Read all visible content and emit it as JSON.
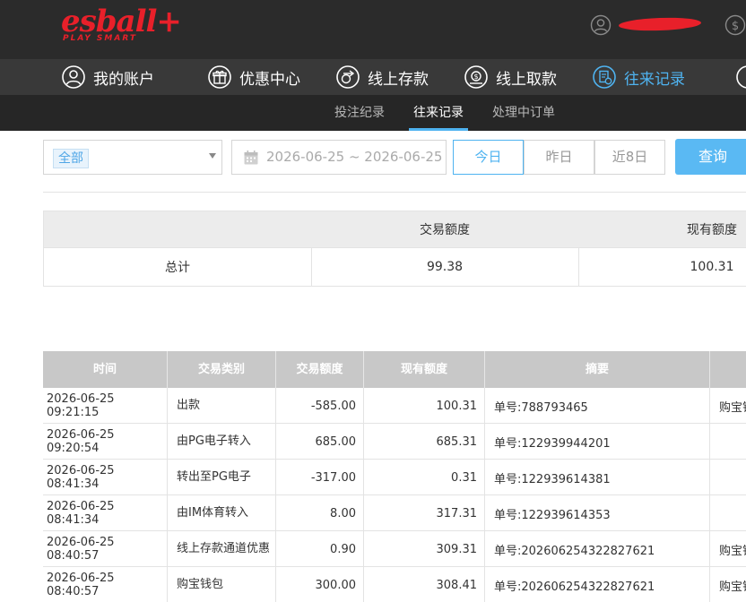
{
  "brand": {
    "logo_text": "esball+",
    "tagline": "PLAY SMART",
    "brand_color": "#e8202a"
  },
  "header": {
    "user_icon": "user-circle-icon",
    "wallet_icon": "dollar-circle-icon"
  },
  "main_nav": [
    {
      "label": "我的账户",
      "icon": "user-circle-icon",
      "active": false
    },
    {
      "label": "优惠中心",
      "icon": "gift-icon",
      "active": false
    },
    {
      "label": "线上存款",
      "icon": "deposit-icon",
      "active": false
    },
    {
      "label": "线上取款",
      "icon": "withdraw-icon",
      "active": false
    },
    {
      "label": "往来记录",
      "icon": "records-icon",
      "active": true
    }
  ],
  "sub_nav": [
    {
      "label": "投注纪录",
      "active": false
    },
    {
      "label": "往来记录",
      "active": true
    },
    {
      "label": "处理中订单",
      "active": false
    }
  ],
  "filters": {
    "type_select": "全部",
    "date_range": "2026-06-25 ~ 2026-06-25",
    "quick_ranges": [
      {
        "label": "今日",
        "active": true
      },
      {
        "label": "昨日",
        "active": false
      },
      {
        "label": "近8日",
        "active": false
      }
    ],
    "query_button": "查询"
  },
  "summary": {
    "headers": [
      "",
      "交易额度",
      "现有额度"
    ],
    "row": {
      "label": "总计",
      "trade_amount": "99.38",
      "balance": "100.31"
    }
  },
  "records": {
    "headers": [
      "时间",
      "交易类别",
      "交易额度",
      "现有额度",
      "摘要",
      ""
    ],
    "rows": [
      {
        "time": "2026-06-25 09:21:15",
        "type": "出款",
        "amount": "-585.00",
        "balance": "100.31",
        "memo": "单号:788793465",
        "extra": "购宝钱"
      },
      {
        "time": "2026-06-25 09:20:54",
        "type": "由PG电子转入",
        "amount": "685.00",
        "balance": "685.31",
        "memo": "单号:122939944201",
        "extra": ""
      },
      {
        "time": "2026-06-25 08:41:34",
        "type": "转出至PG电子",
        "amount": "-317.00",
        "balance": "0.31",
        "memo": "单号:122939614381",
        "extra": ""
      },
      {
        "time": "2026-06-25 08:41:34",
        "type": "由IM体育转入",
        "amount": "8.00",
        "balance": "317.31",
        "memo": "单号:122939614353",
        "extra": ""
      },
      {
        "time": "2026-06-25 08:40:57",
        "type": "线上存款通道优惠",
        "amount": "0.90",
        "balance": "309.31",
        "memo": "单号:202606254322827621",
        "extra": "购宝钱"
      },
      {
        "time": "2026-06-25 08:40:57",
        "type": "购宝钱包",
        "amount": "300.00",
        "balance": "308.41",
        "memo": "单号:202606254322827621",
        "extra": "购宝钱"
      }
    ]
  },
  "colors": {
    "accent": "#4fb3f0",
    "header_bg": "#2b2b2b",
    "nav_bg": "#393939",
    "subnav_bg": "#262626",
    "table_head_bg": "#c8c8c8"
  }
}
